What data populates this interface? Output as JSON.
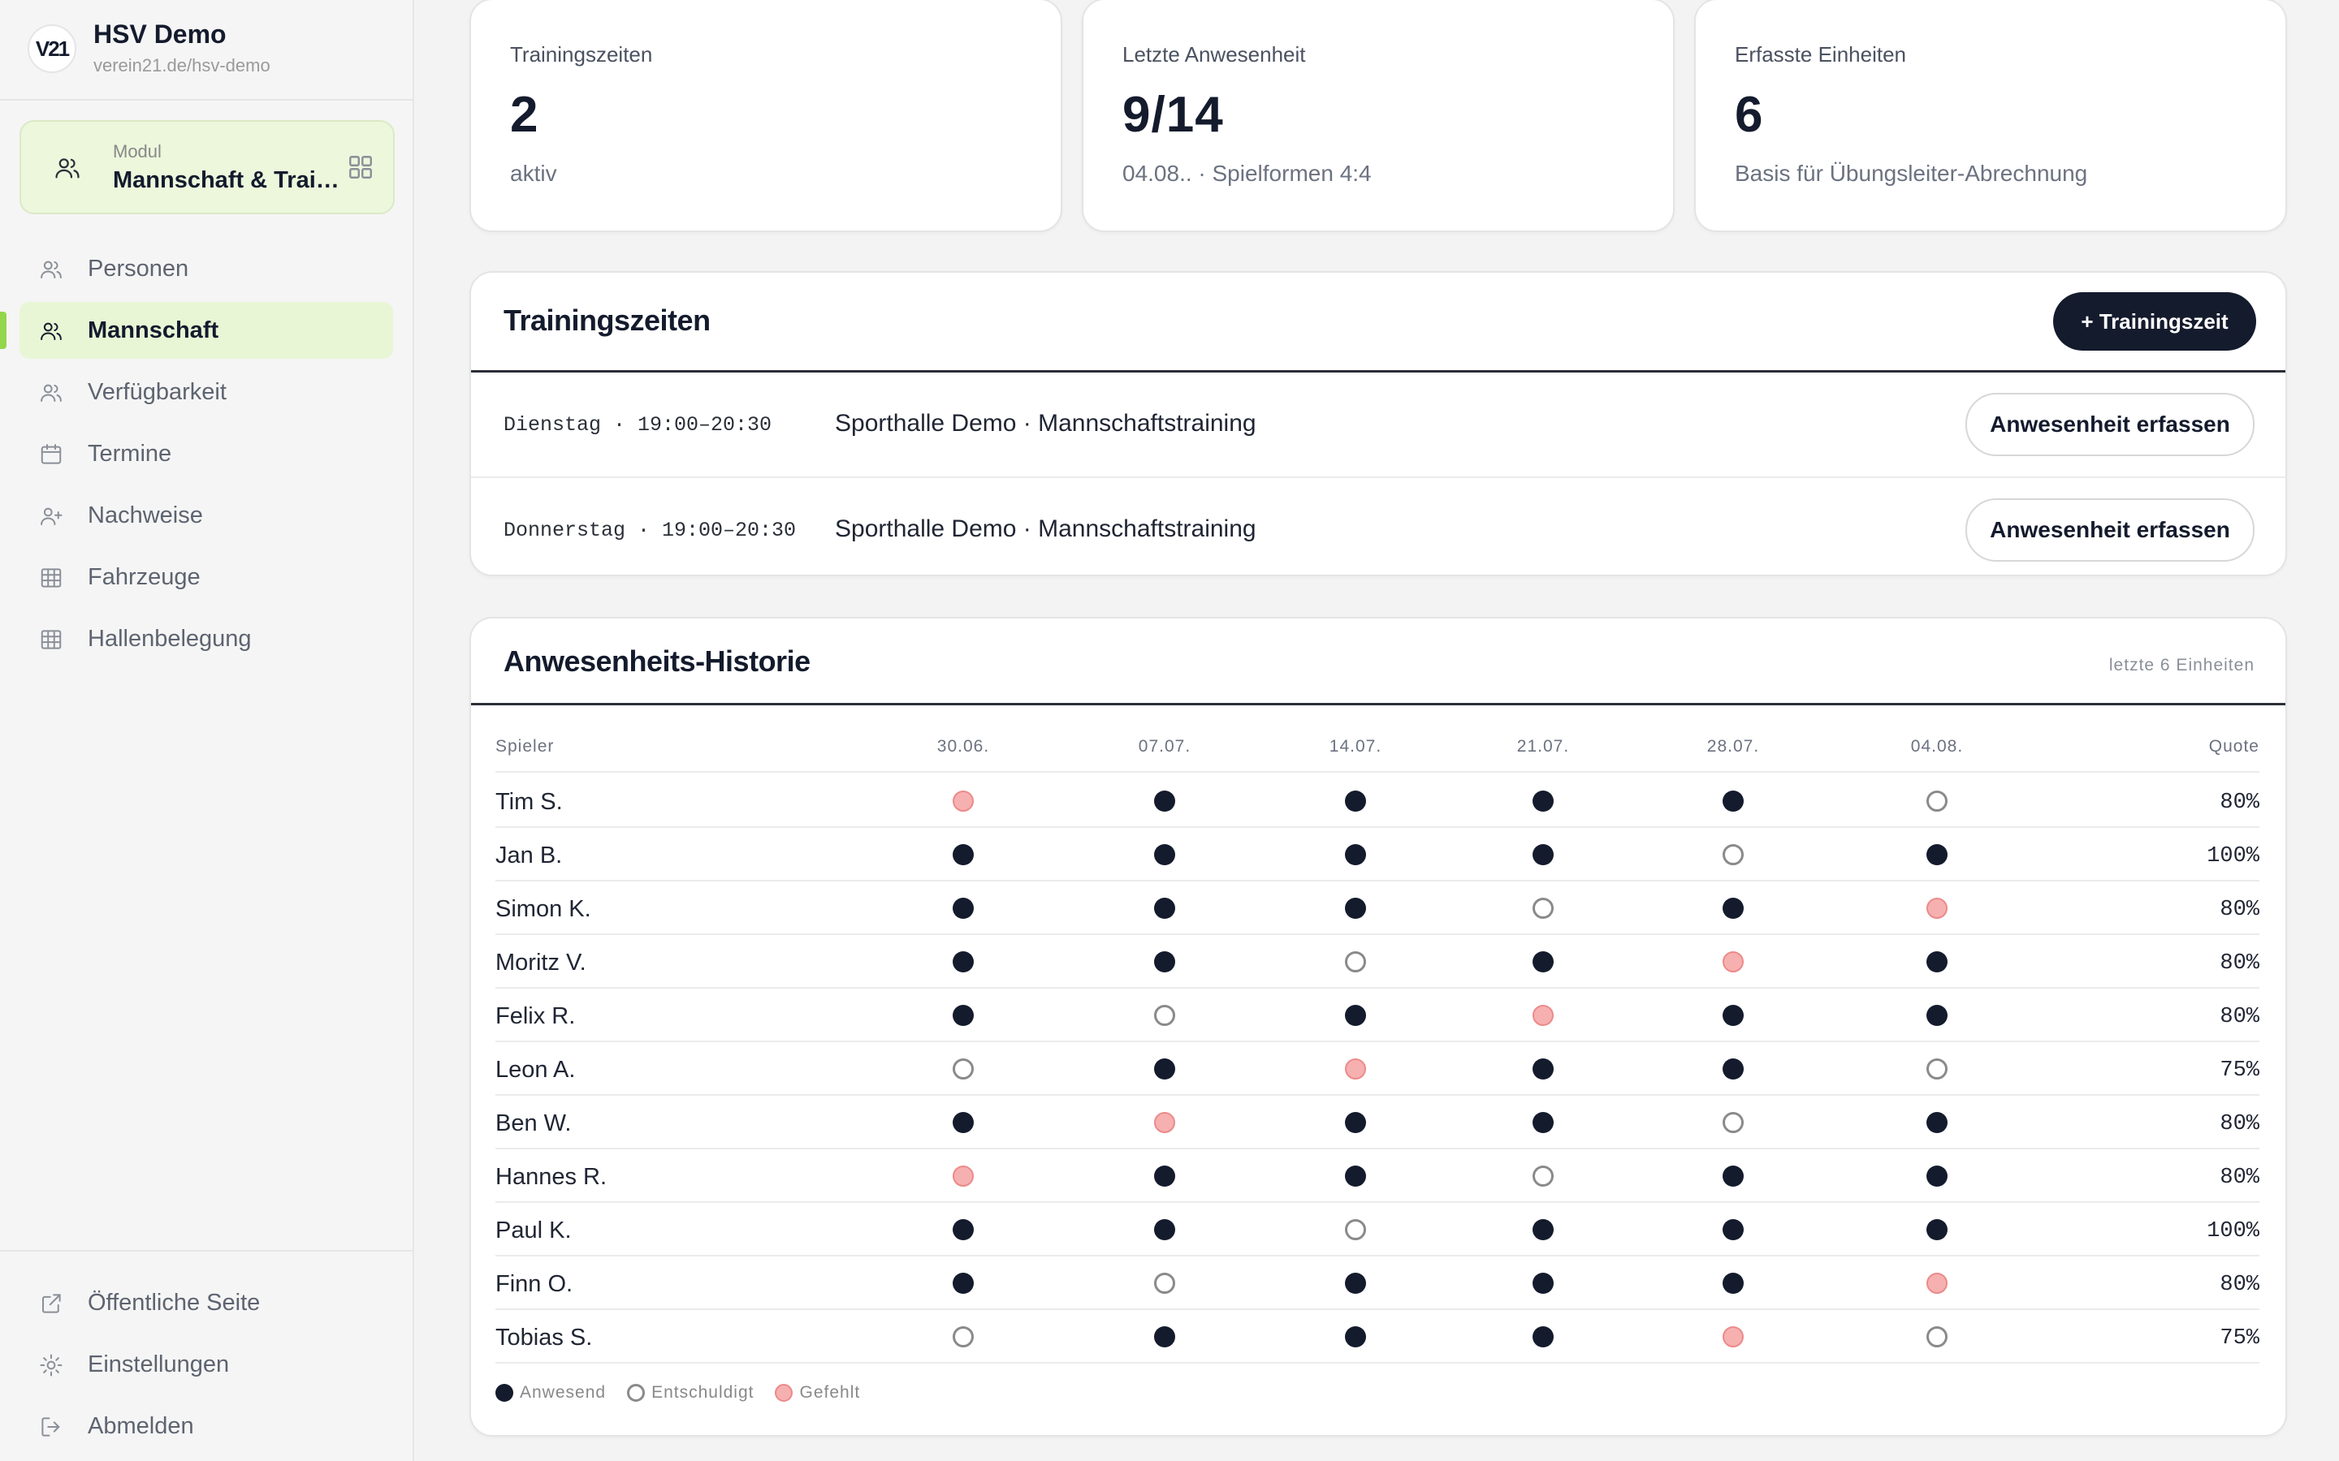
{
  "brand": {
    "logo": "V21",
    "name": "HSV Demo",
    "url": "verein21.de/hsv-demo"
  },
  "module": {
    "label": "Modul",
    "value": "Mannschaft & Trai…"
  },
  "nav": [
    {
      "label": "Personen",
      "icon": "people-icon",
      "active": false
    },
    {
      "label": "Mannschaft",
      "icon": "people-icon",
      "active": true
    },
    {
      "label": "Verfügbarkeit",
      "icon": "people-icon",
      "active": false
    },
    {
      "label": "Termine",
      "icon": "calendar-icon",
      "active": false
    },
    {
      "label": "Nachweise",
      "icon": "user-plus-icon",
      "active": false
    },
    {
      "label": "Fahrzeuge",
      "icon": "table-icon",
      "active": false
    },
    {
      "label": "Hallenbelegung",
      "icon": "table-icon",
      "active": false
    }
  ],
  "footer_nav": [
    {
      "label": "Öffentliche Seite",
      "icon": "external-link-icon"
    },
    {
      "label": "Einstellungen",
      "icon": "gear-icon"
    },
    {
      "label": "Abmelden",
      "icon": "logout-icon"
    }
  ],
  "stats": [
    {
      "label": "Trainingszeiten",
      "value": "2",
      "sub": "aktiv"
    },
    {
      "label": "Letzte Anwesenheit",
      "value": "9/14",
      "sub": "04.08.. · Spielformen 4:4"
    },
    {
      "label": "Erfasste Einheiten",
      "value": "6",
      "sub": "Basis für Übungsleiter-Abrechnung"
    }
  ],
  "training": {
    "title": "Trainingszeiten",
    "add_button": "+ Trainingszeit",
    "slots": [
      {
        "time": "Dienstag · 19:00–20:30",
        "place": "Sporthalle Demo · Mannschaftstraining",
        "action": "Anwesenheit erfassen"
      },
      {
        "time": "Donnerstag · 19:00–20:30",
        "place": "Sporthalle Demo · Mannschaftstraining",
        "action": "Anwesenheit erfassen"
      }
    ]
  },
  "history": {
    "title": "Anwesenheits-Historie",
    "note": "letzte 6 Einheiten",
    "col_player": "Spieler",
    "col_quote": "Quote",
    "dates": [
      "30.06.",
      "07.07.",
      "14.07.",
      "21.07.",
      "28.07.",
      "04.08."
    ],
    "rows": [
      {
        "name": "Tim S.",
        "marks": [
          "g",
          "a",
          "a",
          "a",
          "a",
          "e"
        ],
        "quote": "80%"
      },
      {
        "name": "Jan B.",
        "marks": [
          "a",
          "a",
          "a",
          "a",
          "e",
          "a"
        ],
        "quote": "100%"
      },
      {
        "name": "Simon K.",
        "marks": [
          "a",
          "a",
          "a",
          "e",
          "a",
          "g"
        ],
        "quote": "80%"
      },
      {
        "name": "Moritz V.",
        "marks": [
          "a",
          "a",
          "e",
          "a",
          "g",
          "a"
        ],
        "quote": "80%"
      },
      {
        "name": "Felix R.",
        "marks": [
          "a",
          "e",
          "a",
          "g",
          "a",
          "a"
        ],
        "quote": "80%"
      },
      {
        "name": "Leon A.",
        "marks": [
          "e",
          "a",
          "g",
          "a",
          "a",
          "e"
        ],
        "quote": "75%"
      },
      {
        "name": "Ben W.",
        "marks": [
          "a",
          "g",
          "a",
          "a",
          "e",
          "a"
        ],
        "quote": "80%"
      },
      {
        "name": "Hannes R.",
        "marks": [
          "g",
          "a",
          "a",
          "e",
          "a",
          "a"
        ],
        "quote": "80%"
      },
      {
        "name": "Paul K.",
        "marks": [
          "a",
          "a",
          "e",
          "a",
          "a",
          "a"
        ],
        "quote": "100%"
      },
      {
        "name": "Finn O.",
        "marks": [
          "a",
          "e",
          "a",
          "a",
          "a",
          "g"
        ],
        "quote": "80%"
      },
      {
        "name": "Tobias S.",
        "marks": [
          "e",
          "a",
          "a",
          "a",
          "g",
          "e"
        ],
        "quote": "75%"
      }
    ],
    "legend": [
      {
        "key": "a",
        "label": "Anwesend"
      },
      {
        "key": "e",
        "label": "Entschuldigt"
      },
      {
        "key": "g",
        "label": "Gefehlt"
      }
    ]
  },
  "colors": {
    "accent": "#93d64b",
    "active_bg": "#e8f6d5",
    "dark": "#141b2d",
    "missed": "#f7b0b0"
  }
}
